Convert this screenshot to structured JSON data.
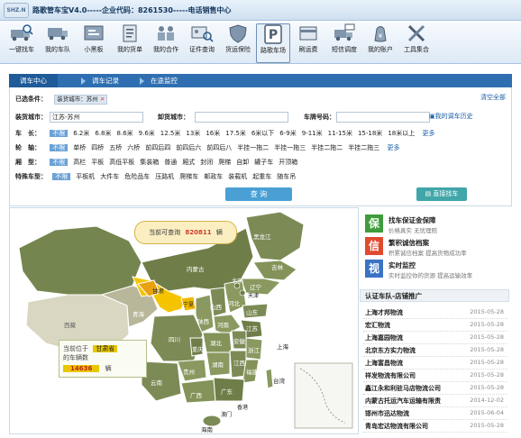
{
  "app": {
    "logo": "SHZ.N",
    "title": "路歌管车宝V4.0-----企业代码：8261530-----电话销售中心"
  },
  "toolbar": [
    {
      "label": "一键找车",
      "icon": "truck-search-icon"
    },
    {
      "label": "我的车队",
      "icon": "fleet-icon"
    },
    {
      "label": "小黑板",
      "icon": "blackboard-icon"
    },
    {
      "label": "我的货单",
      "icon": "cargo-list-icon"
    },
    {
      "label": "我的合作",
      "icon": "cooperation-icon"
    },
    {
      "label": "证件查询",
      "icon": "id-card-search-icon"
    },
    {
      "label": "货运保险",
      "icon": "shield-icon"
    },
    {
      "label": "路歌车场",
      "icon": "parking-p-icon"
    },
    {
      "label": "刷运费",
      "icon": "freight-fee-icon"
    },
    {
      "label": "短信调度",
      "icon": "sms-dispatch-icon"
    },
    {
      "label": "我的账户",
      "icon": "account-icon"
    },
    {
      "label": "工具集合",
      "icon": "tools-icon"
    }
  ],
  "active_toolbar": "路歌车场",
  "tabs": [
    {
      "label": "调车中心"
    },
    {
      "label": "调车记录"
    },
    {
      "label": "在途监控"
    }
  ],
  "filter": {
    "selected_label": "已选条件：",
    "selected_chip": "装货城市：苏州",
    "clear_all": "清空全部",
    "origin_label": "装货城市：",
    "origin_value": "江苏-苏州",
    "dest_label": "卸货城市：",
    "dest_value": "",
    "plate_label": "车牌号码：",
    "plate_value": "",
    "history_link": "我的调车历史",
    "length_label": "车　长：",
    "lengths": [
      "不限",
      "6.2米",
      "6.8米",
      "8.6米",
      "9.6米",
      "12.5米",
      "13米",
      "16米",
      "17.5米",
      "6米以下",
      "6-9米",
      "9-11米",
      "11-15米",
      "15-18米",
      "18米以上"
    ],
    "axle_label": "轮　轴：",
    "axles": [
      "不限",
      "单桥",
      "四桥",
      "五桥",
      "六桥",
      "前四后四",
      "前四后六",
      "前四后八",
      "半挂一拖二",
      "半挂一拖三",
      "半挂二拖二",
      "半挂二拖三"
    ],
    "body_label": "厢　型：",
    "bodies": [
      "不限",
      "高栏",
      "平板",
      "高低平板",
      "集装箱",
      "普通",
      "厢式",
      "封闭",
      "爬梯",
      "自卸",
      "罐子车",
      "开顶箱"
    ],
    "special_label": "特殊车型：",
    "specials": [
      "不限",
      "平板机",
      "大件车",
      "危险品车",
      "压路机",
      "爬梯车",
      "邮政车",
      "装载机",
      "起重车",
      "随车吊"
    ],
    "more": "更多",
    "search_button": "查 询",
    "direct_button": "直接找车"
  },
  "map": {
    "bubble_prefix": "当前可查询",
    "bubble_count": "820811",
    "bubble_unit": "辆",
    "info_prefix": "当前位于",
    "info_region": "甘肃省",
    "info_mid": "的车辆数",
    "info_count": "14636",
    "info_unit": "辆",
    "labels": {
      "heilongjiang": "黑龙江",
      "jilin": "吉林",
      "liaoning": "辽宁",
      "neimenggu": "内蒙古",
      "beijing": "北京",
      "tianjin": "天津",
      "hebei": "河北",
      "shanxi": "山西",
      "shandong": "山东",
      "gansu": "甘肃",
      "ningxia": "宁夏",
      "qinghai": "青海",
      "shaanxi": "陕西",
      "henan": "河南",
      "jiangsu": "江苏",
      "anhui": "安徽",
      "shanghai": "上海",
      "hubei": "湖北",
      "zhejiang": "浙江",
      "sichuan": "四川",
      "chongqing": "重庆",
      "hunan": "湖南",
      "jiangxi": "江西",
      "fujian": "福建",
      "guizhou": "贵州",
      "yunnan": "云南",
      "guangxi": "广西",
      "guangdong": "广东",
      "taiwan": "台湾",
      "xianggang": "香港",
      "aomen": "澳门",
      "hainan": "海南",
      "xizang": "西藏"
    }
  },
  "features": [
    {
      "badge": "保",
      "color": "#3f9c3c",
      "title": "找车保证金保障",
      "desc": "价格真实 无忧理赔"
    },
    {
      "badge": "信",
      "color": "#e04a2f",
      "title": "繁积诚信档案",
      "desc": "积累诚信档案 提高货物成功率"
    },
    {
      "badge": "视",
      "color": "#3a73c4",
      "title": "实时监控",
      "desc": "实时监控你的货源 提高运输效率"
    }
  ],
  "list": {
    "header": "认证车队-店铺推广",
    "items": [
      {
        "name": "上海才邦物流",
        "date": "2015-05-28"
      },
      {
        "name": "宏汇物流",
        "date": "2015-05-28"
      },
      {
        "name": "上海嘉园物流",
        "date": "2015-05-28"
      },
      {
        "name": "北京东方实力物流",
        "date": "2015-05-28"
      },
      {
        "name": "上海富昌物流",
        "date": "2015-05-28"
      },
      {
        "name": "祥发物流有限公司",
        "date": "2015-05-28"
      },
      {
        "name": "鑫江永和利驻马店物流公司",
        "date": "2015-05-28"
      },
      {
        "name": "内蒙古托运汽车运输有限责",
        "date": "2014-12-02"
      },
      {
        "name": "邯州市迅达物流",
        "date": "2015-06-04"
      },
      {
        "name": "青岛宏达物流有限公司",
        "date": "2015-05-28"
      }
    ]
  }
}
